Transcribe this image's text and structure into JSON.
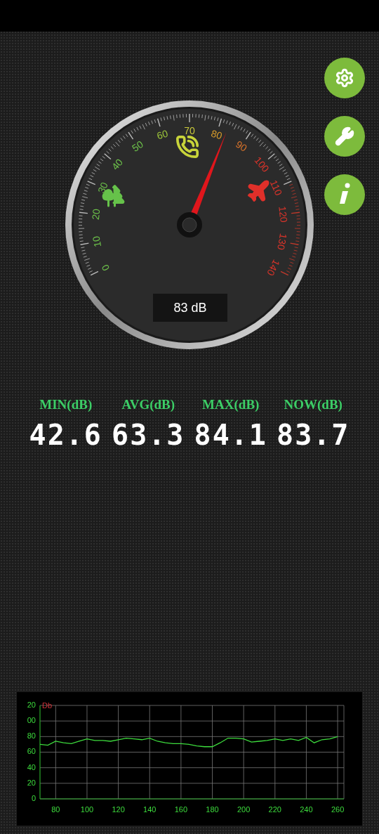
{
  "toolbar": {
    "buttons": [
      {
        "kind": "settings"
      },
      {
        "kind": "tools"
      },
      {
        "kind": "info"
      }
    ]
  },
  "gauge": {
    "readout": "83 dB",
    "scale": [
      {
        "label": "0",
        "color": "#6cc04a"
      },
      {
        "label": "10",
        "color": "#6cc04a"
      },
      {
        "label": "20",
        "color": "#6cc04a"
      },
      {
        "label": "30",
        "color": "#6cc04a"
      },
      {
        "label": "40",
        "color": "#6cc04a"
      },
      {
        "label": "50",
        "color": "#6cc04a"
      },
      {
        "label": "60",
        "color": "#9cc43a"
      },
      {
        "label": "70",
        "color": "#c8c83a"
      },
      {
        "label": "80",
        "color": "#d69a2a"
      },
      {
        "label": "90",
        "color": "#d9732a"
      },
      {
        "label": "100",
        "color": "#d9342a"
      },
      {
        "label": "110",
        "color": "#d9342a"
      },
      {
        "label": "120",
        "color": "#d9342a"
      },
      {
        "label": "130",
        "color": "#d9342a"
      },
      {
        "label": "140",
        "color": "#d9342a"
      }
    ],
    "zones": [
      {
        "kind": "nature",
        "color": "#66c24a"
      },
      {
        "kind": "phone",
        "color": "#c8d43a"
      },
      {
        "kind": "plane",
        "color": "#e0302a"
      }
    ]
  },
  "stats": [
    {
      "label": "MIN(dB)",
      "value": "42.6"
    },
    {
      "label": "AVG(dB)",
      "value": "63.3"
    },
    {
      "label": "MAX(dB)",
      "value": "84.1"
    },
    {
      "label": "NOW(dB)",
      "value": "83.7"
    }
  ],
  "history": {
    "clipped_tick_labels": [
      "20",
      "00"
    ],
    "chart_data": {
      "type": "line",
      "grid": true,
      "ylabel": "Db",
      "xlim": [
        70,
        264
      ],
      "ylim": [
        0,
        120
      ],
      "xticks": [
        80,
        100,
        120,
        140,
        160,
        180,
        200,
        220,
        240,
        260
      ],
      "yticks": [
        0,
        20,
        40,
        60,
        80
      ],
      "x": [
        70,
        75,
        80,
        85,
        90,
        95,
        100,
        105,
        110,
        115,
        120,
        125,
        130,
        135,
        140,
        145,
        150,
        155,
        160,
        165,
        170,
        175,
        180,
        185,
        190,
        195,
        200,
        205,
        210,
        215,
        220,
        225,
        230,
        235,
        240,
        245,
        250,
        255,
        260
      ],
      "series": [
        {
          "color": "#3ddc3d",
          "values": [
            70,
            69,
            74,
            72,
            71,
            74,
            77,
            75,
            75,
            74,
            76,
            78,
            77,
            76,
            78,
            74,
            72,
            71,
            71,
            70,
            68,
            67,
            67,
            72,
            78,
            78,
            77,
            73,
            74,
            75,
            77,
            75,
            77,
            75,
            79,
            72,
            76,
            77,
            80
          ]
        }
      ]
    }
  }
}
